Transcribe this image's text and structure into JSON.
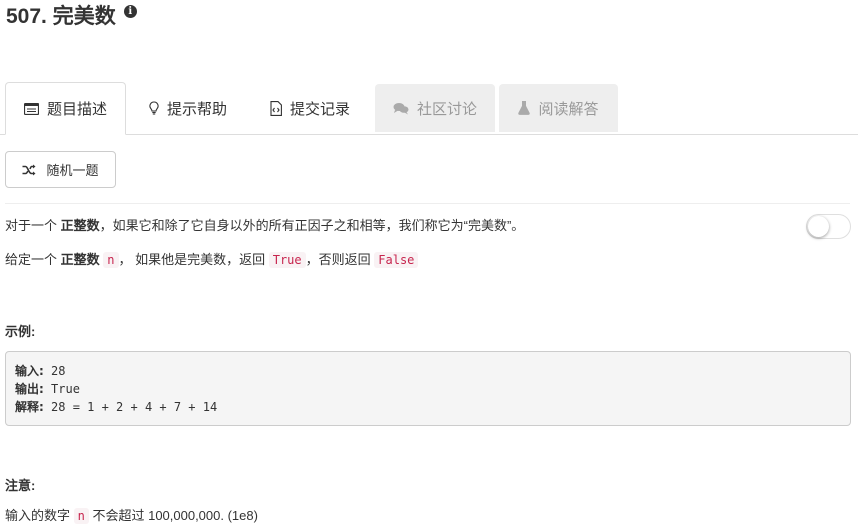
{
  "problem": {
    "title": "507. 完美数",
    "info_icon": "i"
  },
  "tabs": [
    {
      "label": "题目描述",
      "icon": "description-icon",
      "state": "active"
    },
    {
      "label": "提示帮助",
      "icon": "lightbulb-icon",
      "state": "normal"
    },
    {
      "label": "提交记录",
      "icon": "code-file-icon",
      "state": "normal"
    },
    {
      "label": "社区讨论",
      "icon": "comments-icon",
      "state": "disabled"
    },
    {
      "label": "阅读解答",
      "icon": "flask-icon",
      "state": "disabled"
    }
  ],
  "random_button": {
    "label": "随机一题",
    "icon": "shuffle-icon"
  },
  "description": {
    "line1_prefix": "对于一个 ",
    "line1_bold": "正整数",
    "line1_suffix": "，如果它和除了它自身以外的所有正因子之和相等，我们称它为“完美数”。",
    "line2_prefix": "给定一个 ",
    "line2_bold": "正整数",
    "line2_code_n": "n",
    "line2_mid": "， 如果他是完美数，返回 ",
    "line2_code_true": "True",
    "line2_mid2": "，否则返回 ",
    "line2_code_false": "False"
  },
  "example": {
    "label": "示例:",
    "input_key": "输入:",
    "input_value": " 28",
    "output_key": "输出:",
    "output_value": " True",
    "explain_key": "解释:",
    "explain_value": " 28 = 1 + 2 + 4 + 7 + 14"
  },
  "note": {
    "label": "注意:",
    "prefix": "输入的数字 ",
    "code_n": "n",
    "suffix": " 不会超过 100,000,000. (1e8)"
  },
  "toggle": {
    "state": "off"
  },
  "colors": {
    "code_text": "#c7254e",
    "code_bg": "#f9f2f4",
    "disabled_tab_bg": "#eeeeee"
  }
}
